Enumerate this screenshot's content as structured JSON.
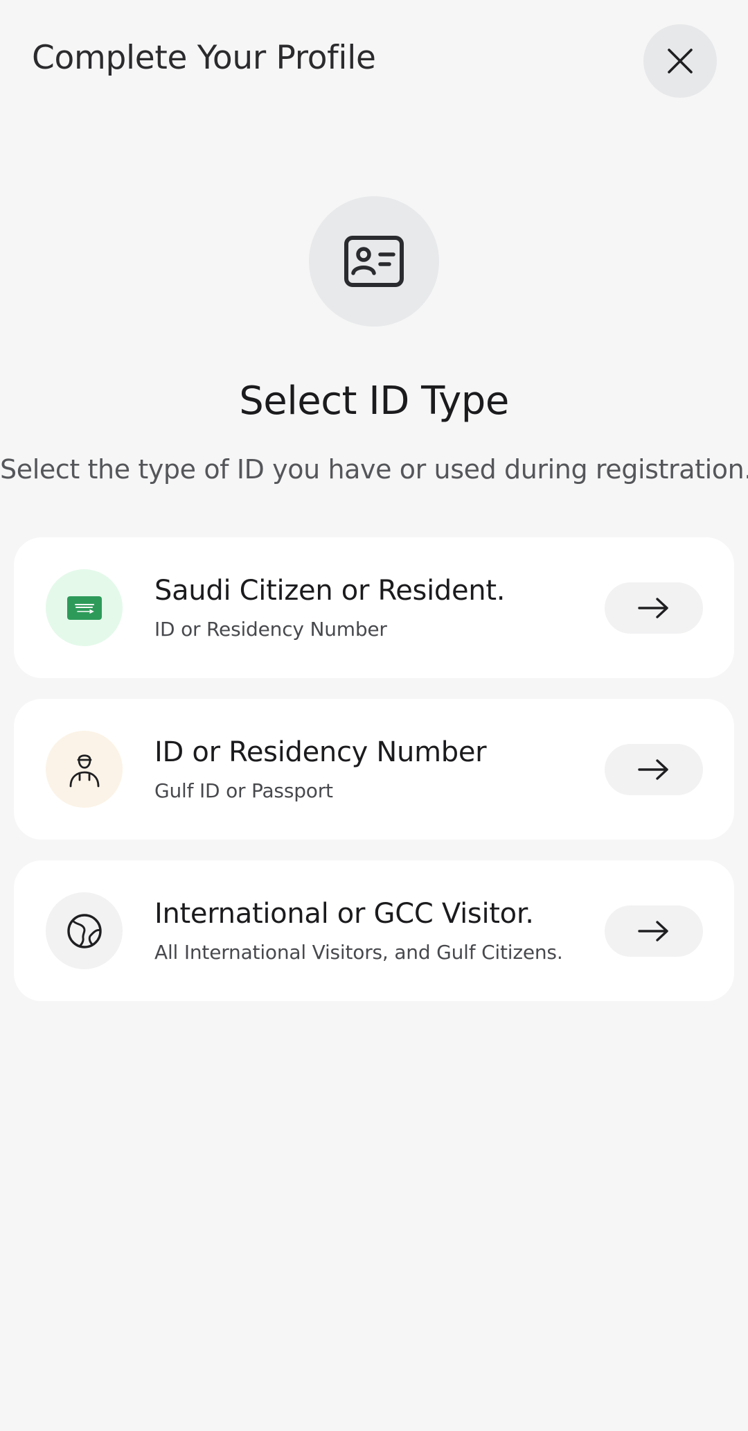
{
  "header": {
    "title": "Complete Your Profile"
  },
  "hero": {
    "icon": "id-card-icon"
  },
  "main": {
    "title": "Select ID Type",
    "subtitle": "Select the type of ID you have or used during registration."
  },
  "options": [
    {
      "title": "Saudi Citizen or Resident.",
      "subtitle": "ID or Residency Number",
      "icon": "saudi-flag-icon",
      "icon_bg": "#e4f9ea",
      "accent": "#2e9a5a"
    },
    {
      "title": "ID or Residency Number",
      "subtitle": "Gulf ID or Passport",
      "icon": "person-headscarf-icon",
      "icon_bg": "#fbf3e7"
    },
    {
      "title": "International or GCC Visitor.",
      "subtitle": "All International Visitors, and Gulf Citizens.",
      "icon": "globe-icon",
      "icon_bg": "#f2f2f3"
    }
  ]
}
